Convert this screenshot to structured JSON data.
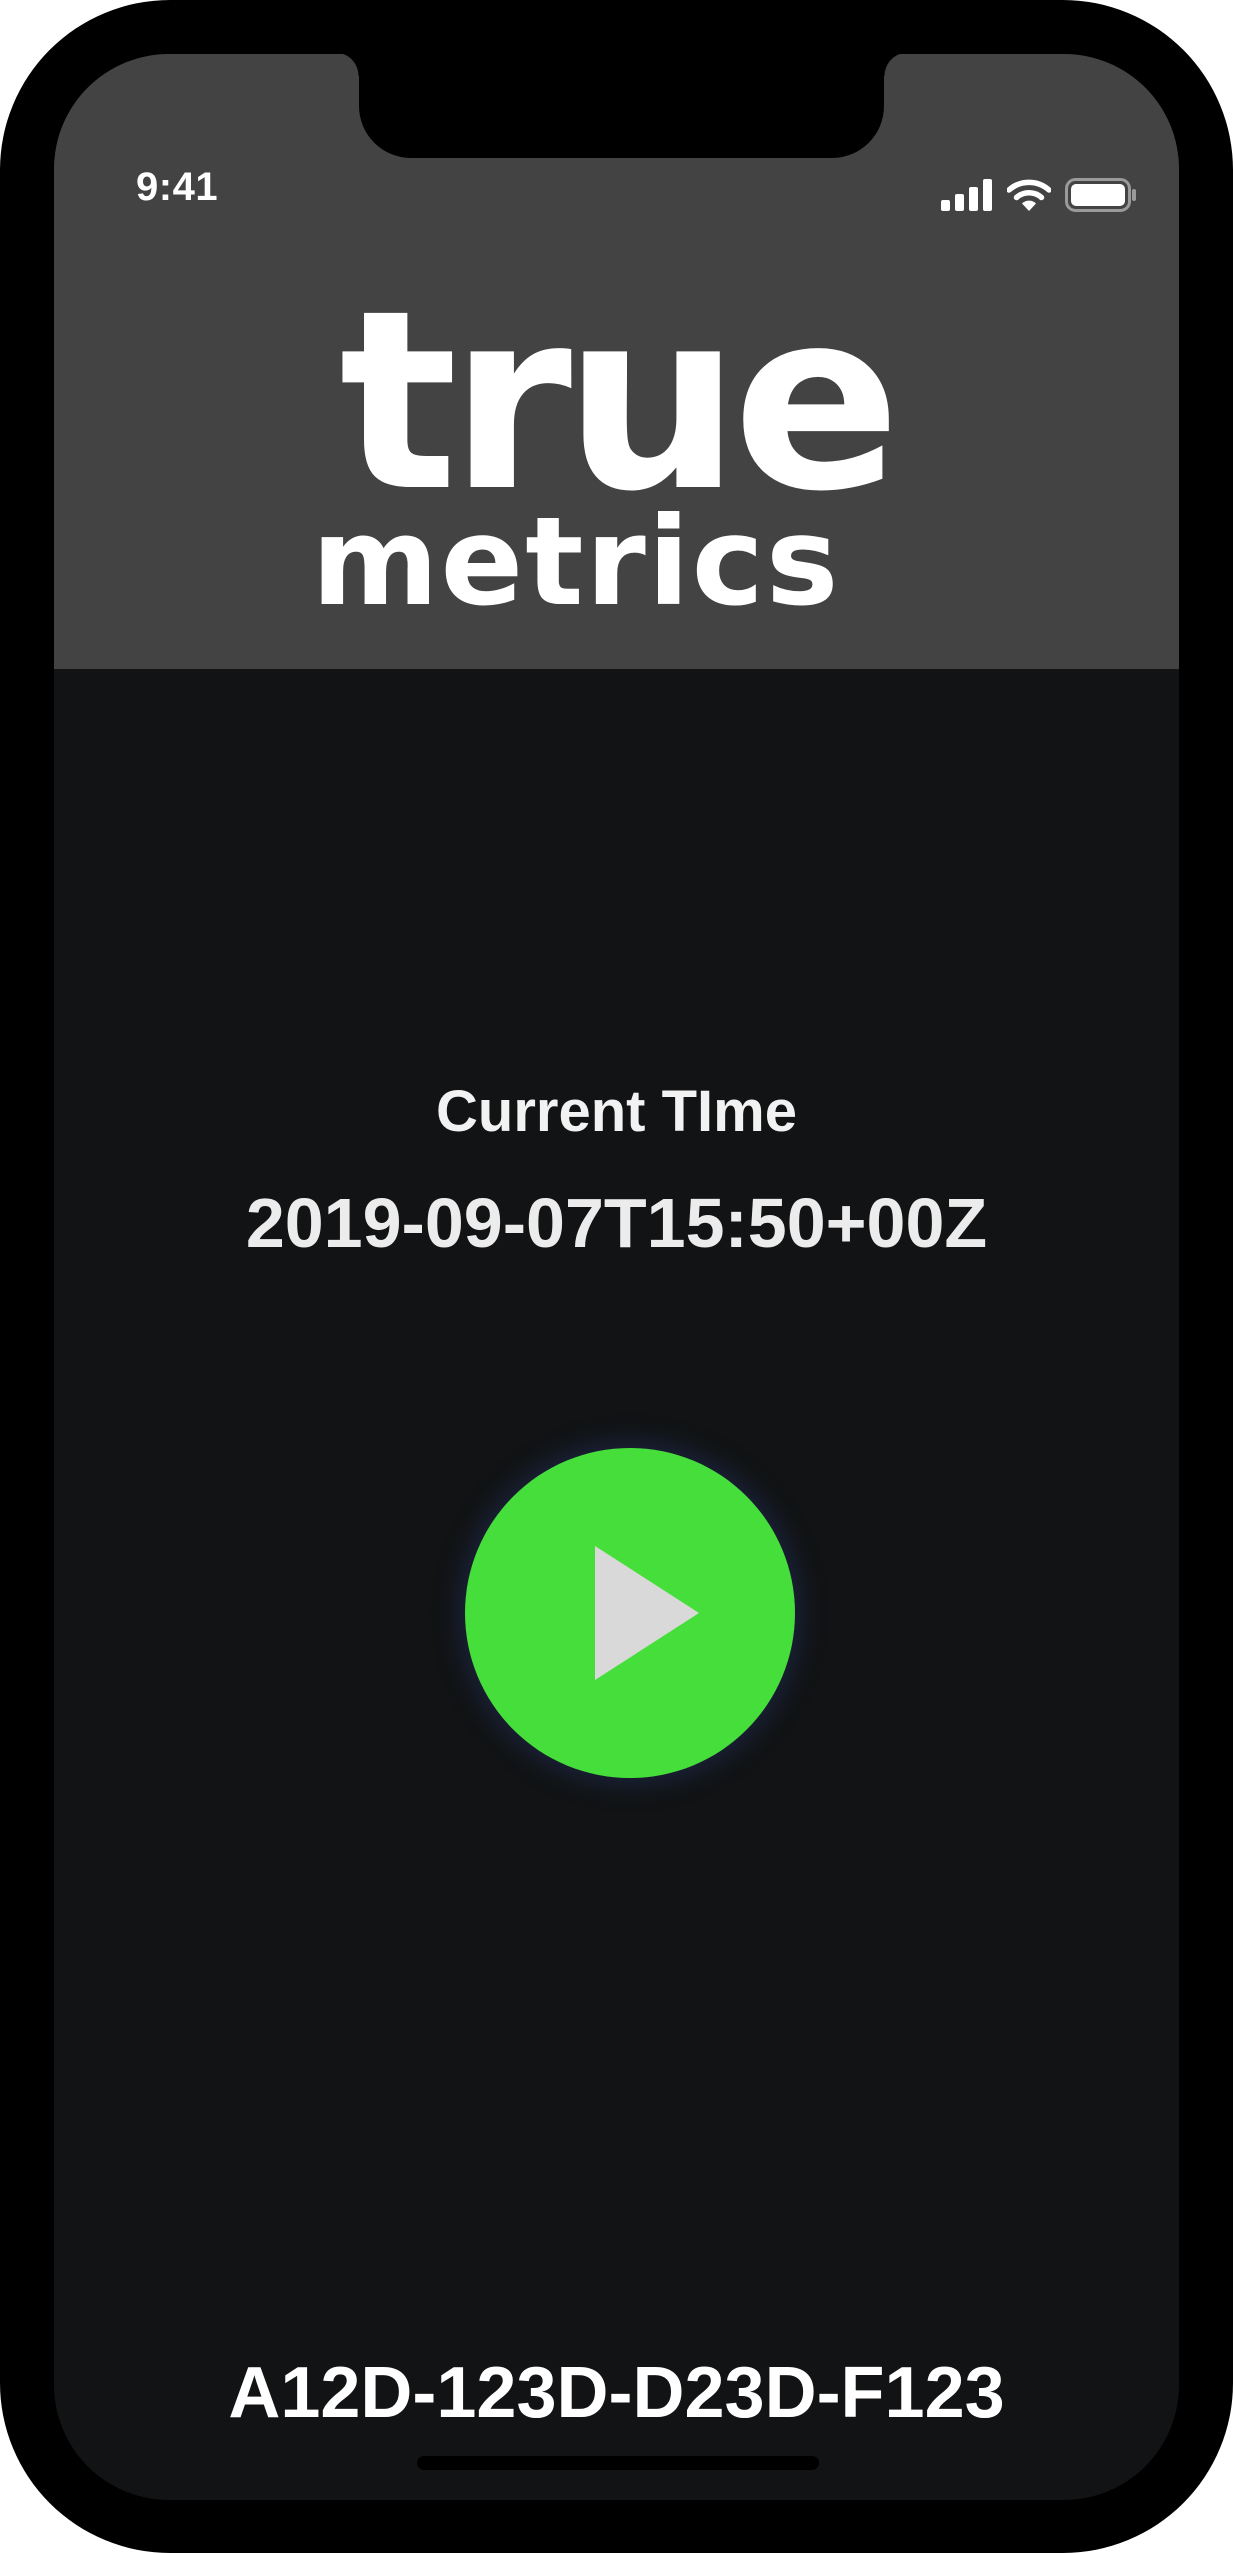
{
  "status_bar": {
    "time": "9:41",
    "icons": [
      "cellular-signal-icon",
      "wifi-icon",
      "battery-icon"
    ]
  },
  "header": {
    "logo_line1": "true",
    "logo_line2": "metrics",
    "background": "#434343"
  },
  "main": {
    "time_label": "Current TIme",
    "time_value": "2019-09-07T15:50+00Z",
    "play_button": {
      "icon": "play-icon",
      "color": "#46de3b"
    },
    "device_id": "A12D-123D-D23D-F123",
    "background": "#111314"
  }
}
